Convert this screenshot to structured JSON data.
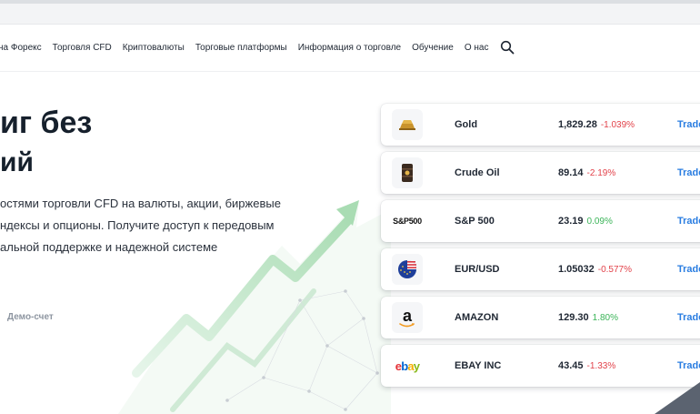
{
  "nav": {
    "items": [
      "на Форекс",
      "Торговля CFD",
      "Криптовалюты",
      "Торговые платформы",
      "Информация о торговле",
      "Обучение",
      "О нас"
    ]
  },
  "hero": {
    "title_line1": "иг без",
    "title_line2": "ий",
    "paragraph": [
      "остями торговли CFD на валюты, акции, биржевые",
      "ндексы и опционы. Получите доступ к передовым",
      "альной поддержке и надежной системе"
    ],
    "demo_link": "Демо-счет"
  },
  "instruments": [
    {
      "name": "Gold",
      "price": "1,829.28",
      "change": "-1.039%",
      "direction": "down",
      "trade": "Trade",
      "icon": "gold-bar-icon"
    },
    {
      "name": "Crude Oil",
      "price": "89.14",
      "change": "-2.19%",
      "direction": "down",
      "trade": "Trade",
      "icon": "oil-barrel-icon"
    },
    {
      "name": "S&P 500",
      "price": "23.19",
      "change": "0.09%",
      "direction": "up",
      "trade": "Trade",
      "icon": "sp500-logo",
      "logo_text": "S&P500"
    },
    {
      "name": "EUR/USD",
      "price": "1.05032",
      "change": "-0.577%",
      "direction": "down",
      "trade": "Trade",
      "icon": "eur-usd-flag-icon"
    },
    {
      "name": "AMAZON",
      "price": "129.30",
      "change": "1.80%",
      "direction": "up",
      "trade": "Trade",
      "icon": "amazon-logo",
      "logo_text": "a"
    },
    {
      "name": "EBAY INC",
      "price": "43.45",
      "change": "-1.33%",
      "direction": "down",
      "trade": "Trade",
      "icon": "ebay-logo",
      "logo_text": "ebay"
    }
  ],
  "colors": {
    "negative": "#e2424a",
    "positive": "#3bb458",
    "link": "#2a7de1",
    "heading": "#16202c"
  }
}
